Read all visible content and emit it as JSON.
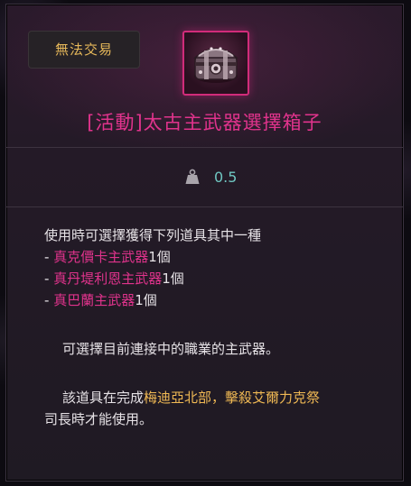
{
  "tag": {
    "label": "無法交易"
  },
  "item": {
    "icon": "treasure-chest-icon",
    "title": "[活動]太古主武器選擇箱子",
    "rarity_color": "#e0338c"
  },
  "weight": {
    "icon": "weight-icon",
    "value": "0.5"
  },
  "description": {
    "intro": "使用時可選擇獲得下列道具其中一種",
    "choices": [
      {
        "prefix": "- ",
        "name": "真克價卡主武器",
        "count": "1個"
      },
      {
        "prefix": "- ",
        "name": "真丹堤利恩主武器",
        "count": "1個"
      },
      {
        "prefix": "- ",
        "name": "真巴蘭主武器",
        "count": "1個"
      }
    ],
    "note": "可選擇目前連接中的職業的主武器。",
    "condition_pre": "該道具在完成",
    "condition_highlight": "梅迪亞北部，擊殺艾爾力克祭",
    "condition_line2": "司長時才能使用。"
  },
  "colors": {
    "pink": "#e0338c",
    "gold": "#f0b954",
    "teal": "#6fc6c1",
    "tag_text": "#e6b85a"
  }
}
